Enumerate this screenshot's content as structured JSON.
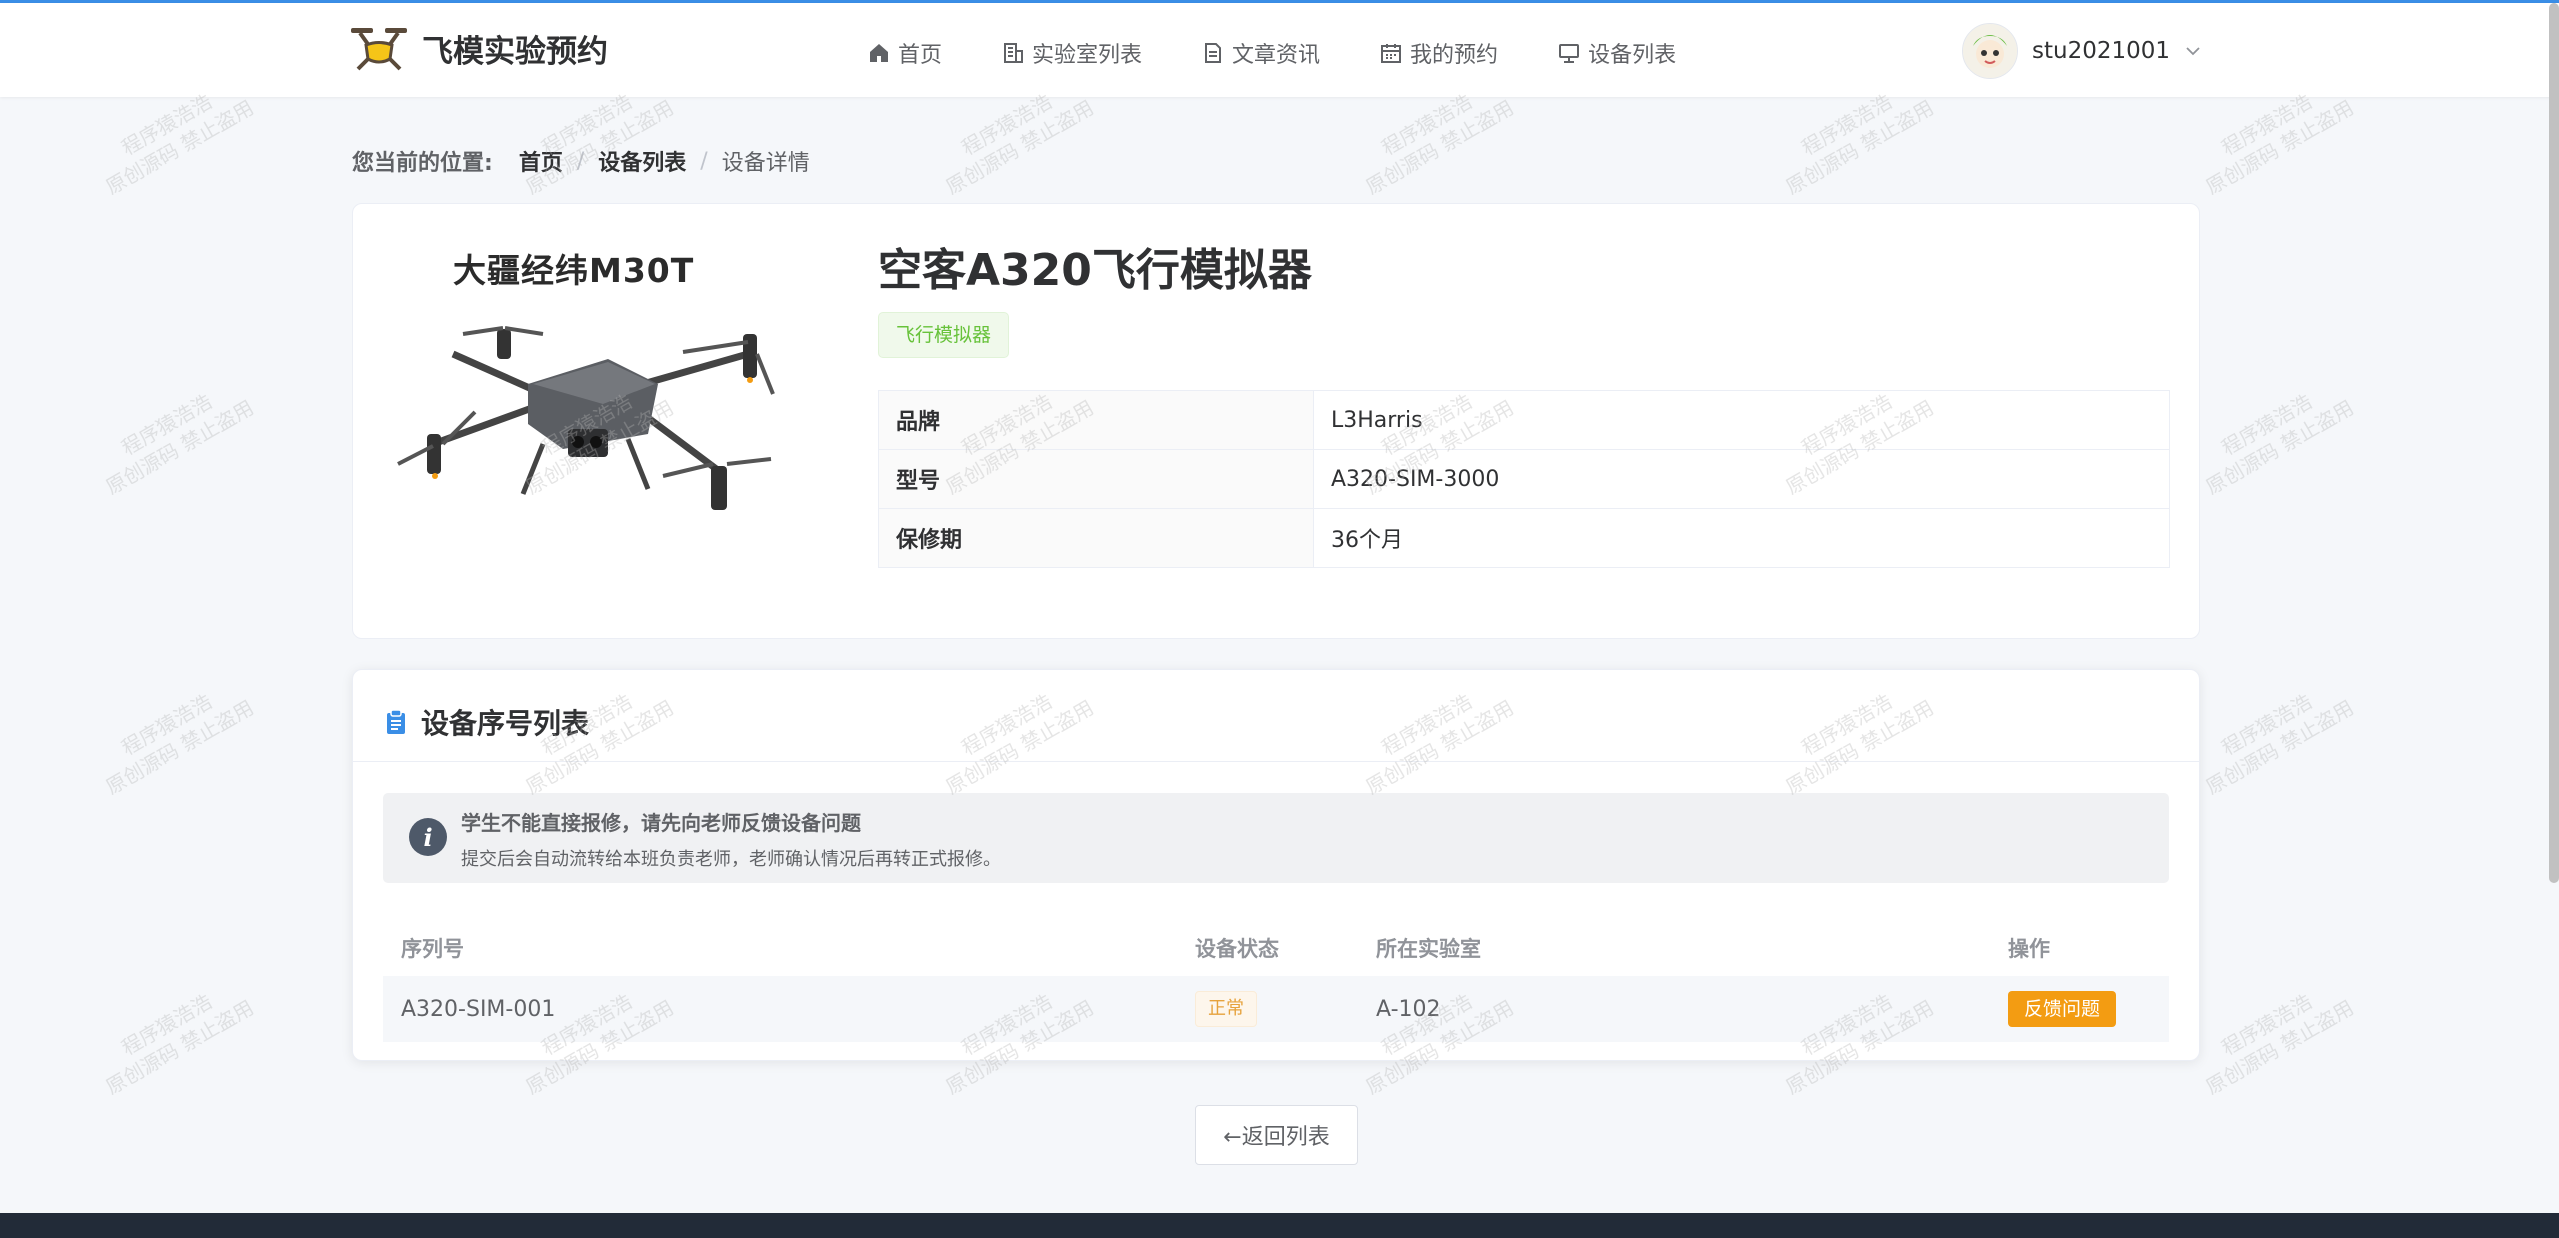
{
  "header": {
    "logo_text": "飞模实验预约",
    "nav": [
      {
        "label": "首页",
        "icon": "home-icon"
      },
      {
        "label": "实验室列表",
        "icon": "building-icon"
      },
      {
        "label": "文章资讯",
        "icon": "document-icon"
      },
      {
        "label": "我的预约",
        "icon": "calendar-icon"
      },
      {
        "label": "设备列表",
        "icon": "monitor-icon"
      }
    ],
    "username": "stu2021001"
  },
  "breadcrumb": {
    "label": "您当前的位置:",
    "items": [
      "首页",
      "设备列表",
      "设备详情"
    ]
  },
  "product": {
    "image_caption": "大疆经纬M30T",
    "title": "空客A320飞行模拟器",
    "tag": "飞行模拟器",
    "specs": [
      {
        "key": "品牌",
        "value": "L3Harris"
      },
      {
        "key": "型号",
        "value": "A320-SIM-3000"
      },
      {
        "key": "保修期",
        "value": "36个月"
      }
    ]
  },
  "serials": {
    "title": "设备序号列表",
    "alert_title": "学生不能直接报修，请先向老师反馈设备问题",
    "alert_desc": "提交后会自动流转给本班负责老师，老师确认情况后再转正式报修。",
    "columns": [
      "序列号",
      "设备状态",
      "所在实验室",
      "操作"
    ],
    "rows": [
      {
        "serial": "A320-SIM-001",
        "status": "正常",
        "lab": "A-102",
        "action": "反馈问题"
      }
    ]
  },
  "back_label": "←返回列表",
  "watermark": [
    "程序猿浩浩",
    "原创源码 禁止盗用"
  ]
}
